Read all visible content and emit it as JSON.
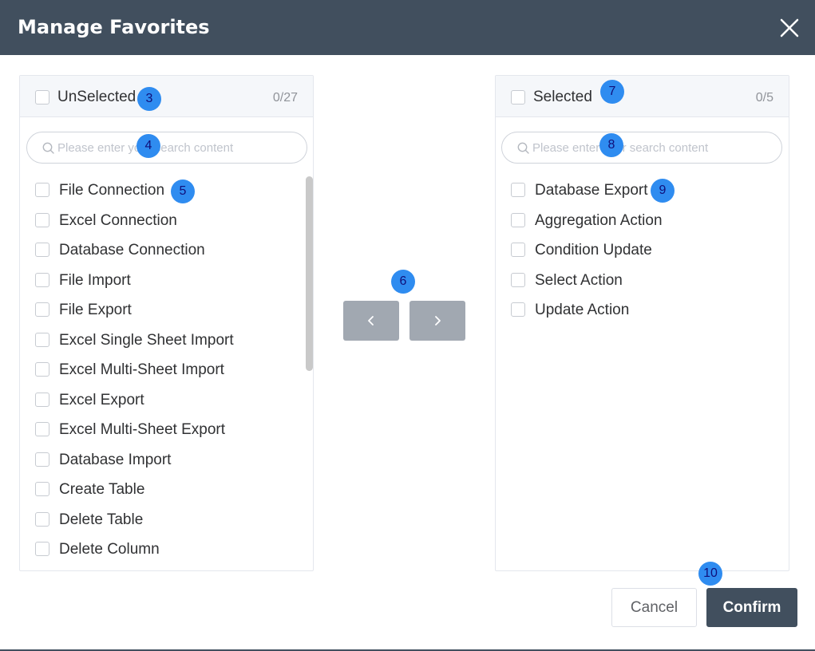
{
  "dialog": {
    "title": "Manage Favorites",
    "close_icon": "close-icon"
  },
  "left_panel": {
    "header_label": "UnSelected",
    "count": "0/27",
    "search_placeholder": "Please enter your search content",
    "items": [
      "File Connection",
      "Excel Connection",
      "Database Connection",
      "File Import",
      "File Export",
      "Excel Single Sheet Import",
      "Excel Multi-Sheet Import",
      "Excel Export",
      "Excel Multi-Sheet Export",
      "Database Import",
      "Create Table",
      "Delete Table",
      "Delete Column"
    ]
  },
  "right_panel": {
    "header_label": "Selected",
    "count": "0/5",
    "search_placeholder": "Please enter your search content",
    "items": [
      "Database Export",
      "Aggregation Action",
      "Condition Update",
      "Select Action",
      "Update Action"
    ]
  },
  "transfer": {
    "left_icon": "chevron-left-icon",
    "right_icon": "chevron-right-icon"
  },
  "footer": {
    "cancel_label": "Cancel",
    "confirm_label": "Confirm"
  },
  "markers": [
    "3",
    "4",
    "5",
    "6",
    "7",
    "8",
    "9",
    "10"
  ],
  "colors": {
    "header": "#414f5e",
    "arrow_button": "#a1a8b1",
    "marker": "#2f8cf0"
  }
}
